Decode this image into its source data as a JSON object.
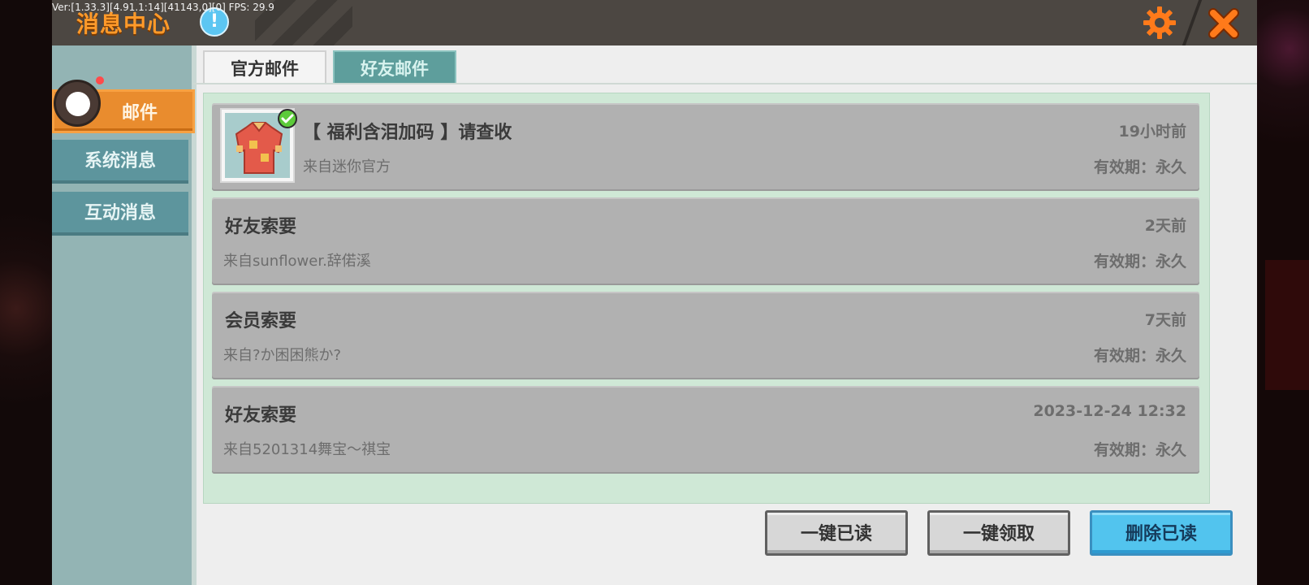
{
  "header": {
    "debug_text": "Ver:[1.33.3][4.91.1:14][41143,0][0] FPS: 29.9",
    "title": "消息中心",
    "info_icon": "exclamation-icon",
    "gear_icon": "gear-icon",
    "close_icon": "close-icon"
  },
  "sidebar": {
    "items": [
      {
        "label": "邮件",
        "active": true
      },
      {
        "label": "系统消息",
        "active": false
      },
      {
        "label": "互动消息",
        "active": false
      }
    ]
  },
  "tabs": [
    {
      "label": "官方邮件",
      "active": true
    },
    {
      "label": "好友邮件",
      "active": false
    }
  ],
  "mails": [
    {
      "title": "【 福利含泪加码 】请查收",
      "from": "来自迷你官方",
      "time": "19小时前",
      "validity": "有效期：永久",
      "has_item": true
    },
    {
      "title": "好友索要",
      "from": "来自sunflower.辞偌溪",
      "time": "2天前",
      "validity": "有效期：永久",
      "has_item": false
    },
    {
      "title": "会员索要",
      "from": "来自?か困困熊か?",
      "time": "7天前",
      "validity": "有效期：永久",
      "has_item": false
    },
    {
      "title": "好友索要",
      "from": "来自5201314舞宝～祺宝",
      "time": "2023-12-24 12:32",
      "validity": "有效期：永久",
      "has_item": false
    }
  ],
  "buttons": {
    "mark_all_read": "一键已读",
    "claim_all": "一键领取",
    "delete_read": "删除已读"
  },
  "colors": {
    "accent_orange": "#ff9a2a",
    "sidebar_teal": "#5d959d",
    "delete_button_blue": "#52c4ee"
  }
}
